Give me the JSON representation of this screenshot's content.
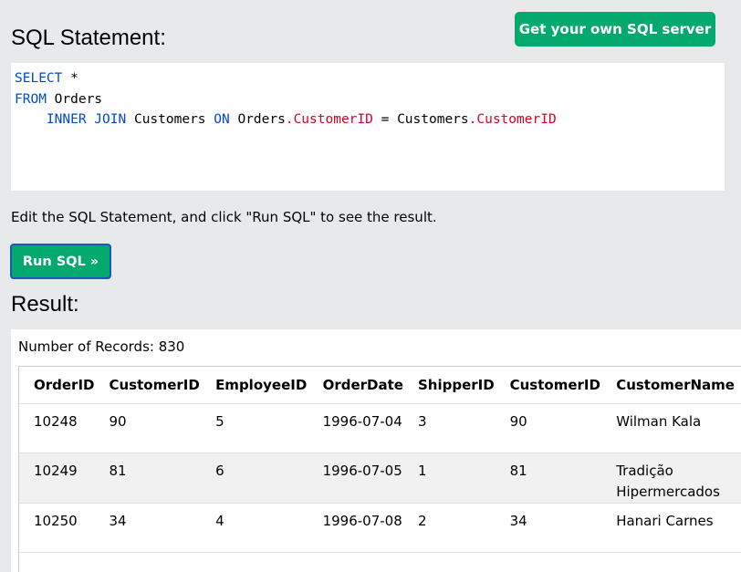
{
  "header": {
    "sql_title": "SQL Statement:",
    "server_button": "Get your own SQL server"
  },
  "editor": {
    "line1_kw": "SELECT",
    "line1_rest": " *",
    "line2_kw": "FROM",
    "line2_rest": " Orders",
    "line3_indent": "    ",
    "line3_kw1": "INNER JOIN",
    "line3_t1": " Customers ",
    "line3_kw2": "ON",
    "line3_t2": " Orders",
    "line3_c1": ".CustomerID",
    "line3_t3": " = Customers",
    "line3_c2": ".CustomerID"
  },
  "hint": "Edit the SQL Statement, and click \"Run SQL\" to see the result.",
  "run_button": "Run SQL »",
  "result": {
    "title": "Result:",
    "records": "Number of Records: 830",
    "columns": [
      "OrderID",
      "CustomerID",
      "EmployeeID",
      "OrderDate",
      "ShipperID",
      "CustomerID",
      "CustomerName"
    ],
    "rows": [
      [
        "10248",
        "90",
        "5",
        "1996-07-04",
        "3",
        "90",
        "Wilman Kala"
      ],
      [
        "10249",
        "81",
        "6",
        "1996-07-05",
        "1",
        "81",
        "Tradição Hipermercados"
      ],
      [
        "10250",
        "34",
        "4",
        "1996-07-08",
        "2",
        "34",
        "Hanari Carnes"
      ]
    ]
  },
  "colors": {
    "accent": "#04aa6d",
    "keyword": "#0049d1",
    "column_ref": "#dd0021",
    "background": "#e7e9eb"
  }
}
